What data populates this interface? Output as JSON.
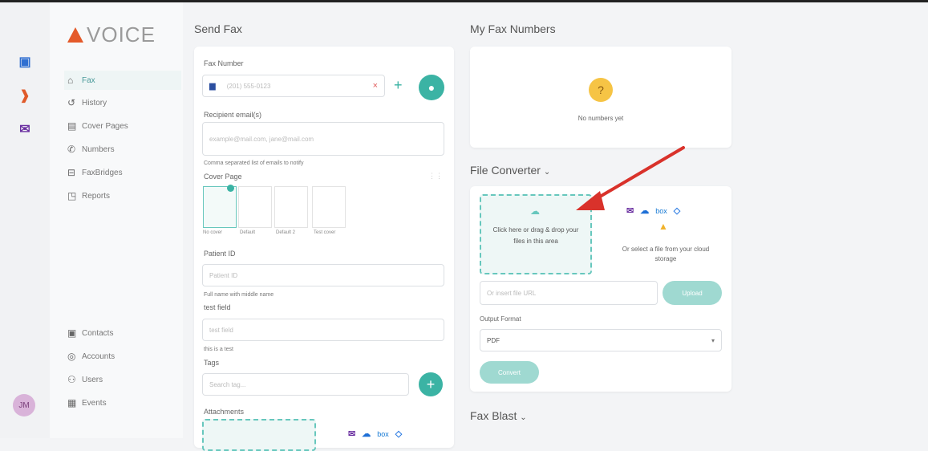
{
  "brand": {
    "name": "VOICE"
  },
  "rail": {
    "avatar_initials": "JM"
  },
  "sidebar": {
    "items": [
      {
        "label": "Fax",
        "icon": "fax-icon"
      },
      {
        "label": "History",
        "icon": "history-icon"
      },
      {
        "label": "Cover Pages",
        "icon": "document-icon"
      },
      {
        "label": "Numbers",
        "icon": "phone-icon"
      },
      {
        "label": "FaxBridges",
        "icon": "bridge-icon"
      },
      {
        "label": "Reports",
        "icon": "reports-icon"
      }
    ],
    "bottom_items": [
      {
        "label": "Contacts",
        "icon": "contacts-icon"
      },
      {
        "label": "Accounts",
        "icon": "accounts-icon"
      },
      {
        "label": "Users",
        "icon": "users-icon"
      },
      {
        "label": "Events",
        "icon": "events-icon"
      }
    ]
  },
  "send_fax": {
    "title": "Send Fax",
    "fax_number_label": "Fax Number",
    "fax_number_placeholder": "(201) 555-0123",
    "recipient_label": "Recipient email(s)",
    "recipient_placeholder": "example@mail.com, jane@mail.com",
    "recipient_hint": "Comma separated list of emails to notify",
    "cover_page_label": "Cover Page",
    "cover_pages": [
      "No cover",
      "Default",
      "Default 2",
      "Test cover"
    ],
    "patient_label": "Patient ID",
    "patient_placeholder": "Patient ID",
    "patient_hint": "Full name with middle name",
    "test_label": "test field",
    "test_placeholder": "test field",
    "test_hint": "this is a test",
    "tags_label": "Tags",
    "tags_placeholder": "Search tag...",
    "attachments_label": "Attachments"
  },
  "my_fax_numbers": {
    "title": "My Fax Numbers",
    "empty_text": "No numbers yet"
  },
  "file_converter": {
    "title": "File Converter",
    "dropzone_text": "Click here or drag & drop your files in this area",
    "cloud_text": "Or select a file from your cloud storage",
    "url_placeholder": "Or insert file URL",
    "upload_label": "Upload",
    "output_label": "Output Format",
    "output_value": "PDF",
    "convert_label": "Convert"
  },
  "fax_blast": {
    "title": "Fax Blast"
  },
  "colors": {
    "accent": "#3bb3a4",
    "arrow": "#d9322b"
  }
}
